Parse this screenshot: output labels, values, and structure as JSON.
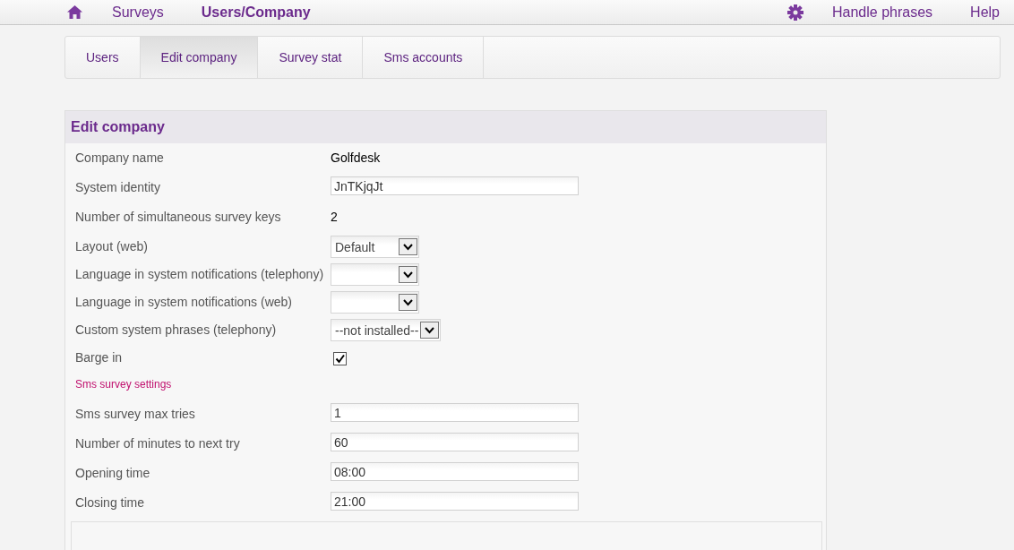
{
  "nav": {
    "items": [
      {
        "label": "Surveys",
        "selected": false
      },
      {
        "label": "Users/Company",
        "selected": true
      }
    ],
    "right_items": [
      "Handle phrases",
      "Help"
    ]
  },
  "tabs": [
    {
      "label": "Users",
      "selected": false
    },
    {
      "label": "Edit company",
      "selected": true
    },
    {
      "label": "Survey stat",
      "selected": false
    },
    {
      "label": "Sms accounts",
      "selected": false
    }
  ],
  "panel": {
    "title": "Edit company",
    "rows": [
      {
        "kind": "text",
        "label": "Company name",
        "value": "Golfdesk"
      },
      {
        "kind": "input",
        "label": "System identity",
        "value": "JnTKjqJt"
      },
      {
        "kind": "text",
        "label": "Number of simultaneous survey keys",
        "value": "2"
      },
      {
        "kind": "select",
        "label": "Layout (web)",
        "value": "Default"
      },
      {
        "kind": "select",
        "label": "Language in system notifications (telephony)"
      },
      {
        "kind": "select",
        "label": "Language in system notifications (web)"
      },
      {
        "kind": "select",
        "label": "Custom system phrases (telephony)",
        "value": "--not installed--"
      },
      {
        "kind": "checkbox",
        "label": "Barge in",
        "checked": true
      },
      {
        "kind": "section",
        "label": "Sms survey settings"
      },
      {
        "kind": "input",
        "label": "Sms survey max tries",
        "value": "1"
      },
      {
        "kind": "input",
        "label": "Number of minutes to next try",
        "value": "60"
      },
      {
        "kind": "input",
        "label": "Opening time",
        "value": "08:00"
      },
      {
        "kind": "input",
        "label": "Closing time",
        "value": "21:00"
      }
    ]
  }
}
